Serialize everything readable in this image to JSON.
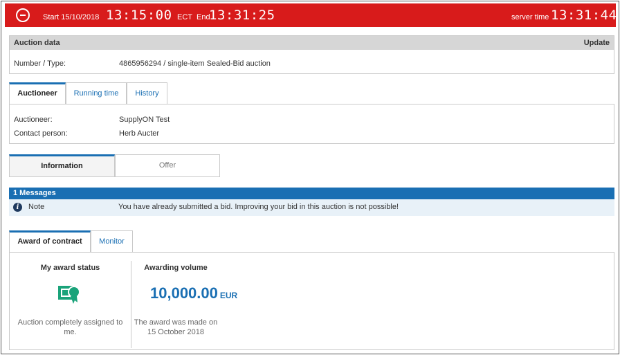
{
  "topbar": {
    "start_label": "Start 15/10/2018",
    "start_time": "13:15:00",
    "start_zone": "ECT",
    "end_label": "End",
    "end_time": "13:31:25",
    "server_label": "server time",
    "server_time": "13:31:44"
  },
  "auction_data": {
    "title": "Auction data",
    "update_label": "Update",
    "number_type_label": "Number / Type:",
    "number_type_value": "4865956294 / single-item Sealed-Bid auction"
  },
  "auctioneer_tabs": [
    "Auctioneer",
    "Running time",
    "History"
  ],
  "auctioneer": {
    "auctioneer_label": "Auctioneer:",
    "auctioneer_value": "SupplyON Test",
    "contact_label": "Contact person:",
    "contact_value": "Herb Aucter"
  },
  "segments": [
    "Information",
    "Offer"
  ],
  "messages": {
    "header": "1 Messages",
    "note_label": "Note",
    "note_text": "You have already submitted a bid. Improving your bid in this auction is not possible!"
  },
  "award_tabs": [
    "Award of contract",
    "Monitor"
  ],
  "award": {
    "status_title": "My award status",
    "status_text_1": "Auction completely assigned to",
    "status_text_2": "me.",
    "volume_title": "Awarding volume",
    "amount": "10,000.00",
    "currency": "EUR",
    "award_text_1": "The award was made on",
    "award_text_2": "15 October 2018"
  },
  "colors": {
    "topbar_red": "#d81b1b",
    "accent_blue": "#1a6fb3",
    "award_icon_green": "#1aa37a"
  }
}
